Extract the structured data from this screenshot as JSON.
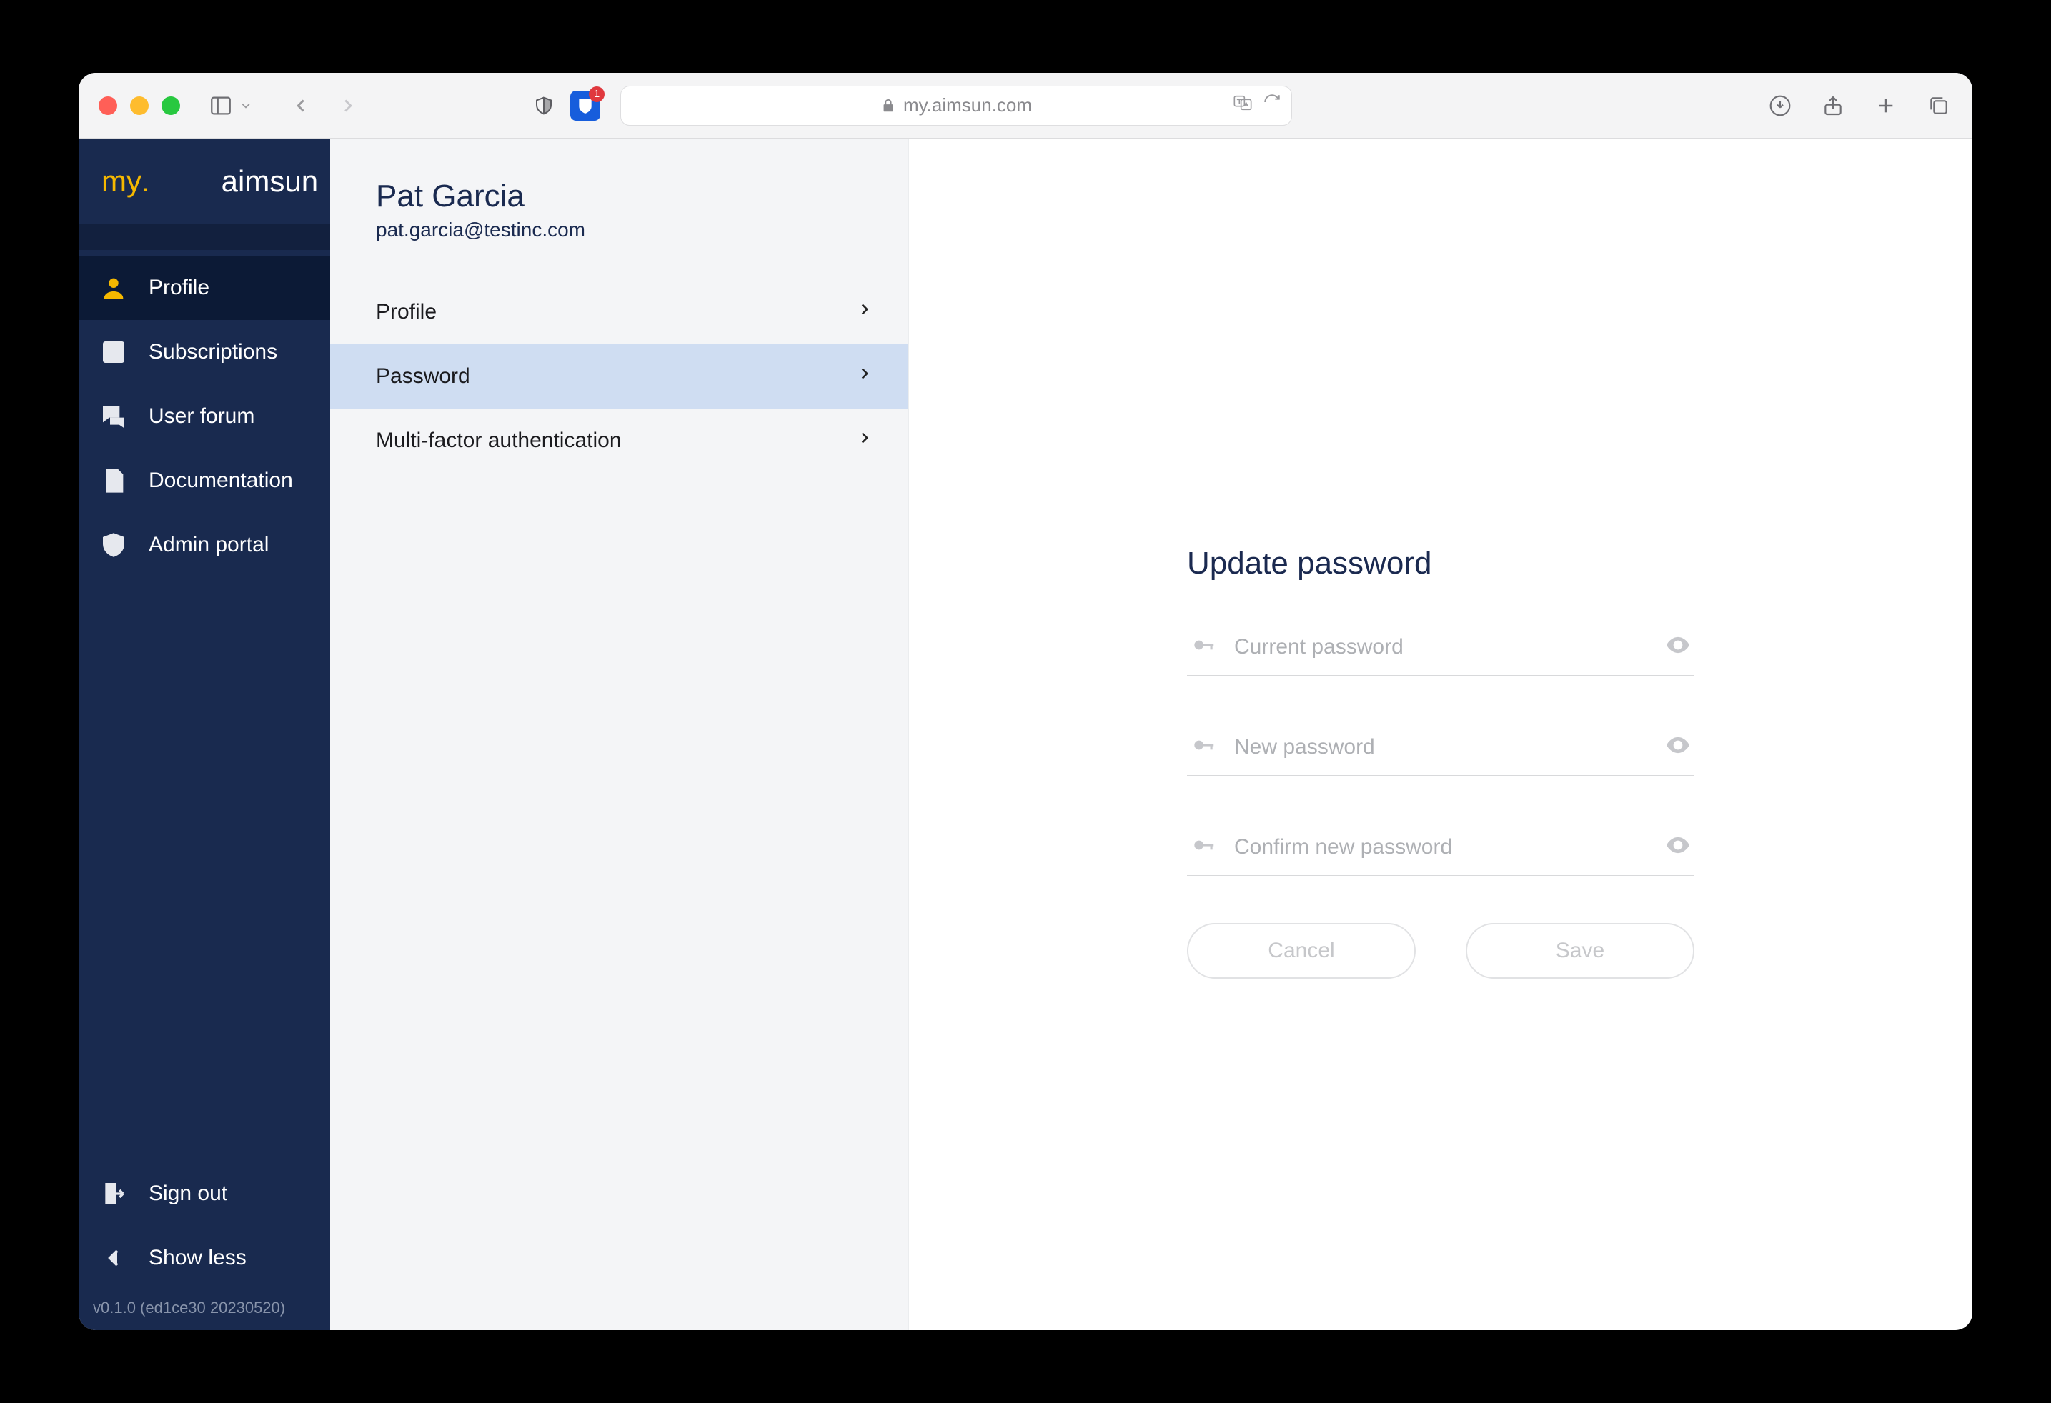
{
  "browser": {
    "url_host": "my.aimsun.com",
    "extension_badge": "1"
  },
  "app": {
    "brand_pre": "my",
    "brand_dot": ".",
    "brand_main": "aimsun",
    "version": "v0.1.0 (ed1ce30 20230520)"
  },
  "sidebar": {
    "items": [
      {
        "label": "Profile"
      },
      {
        "label": "Subscriptions"
      },
      {
        "label": "User forum"
      },
      {
        "label": "Documentation"
      },
      {
        "label": "Admin portal"
      }
    ],
    "signout": "Sign out",
    "showless": "Show less"
  },
  "user": {
    "name": "Pat Garcia",
    "email": "pat.garcia@testinc.com"
  },
  "tabs": [
    {
      "label": "Profile"
    },
    {
      "label": "Password"
    },
    {
      "label": "Multi-factor authentication"
    }
  ],
  "form": {
    "title": "Update password",
    "current_ph": "Current password",
    "new_ph": "New password",
    "confirm_ph": "Confirm new password",
    "cancel": "Cancel",
    "save": "Save"
  }
}
